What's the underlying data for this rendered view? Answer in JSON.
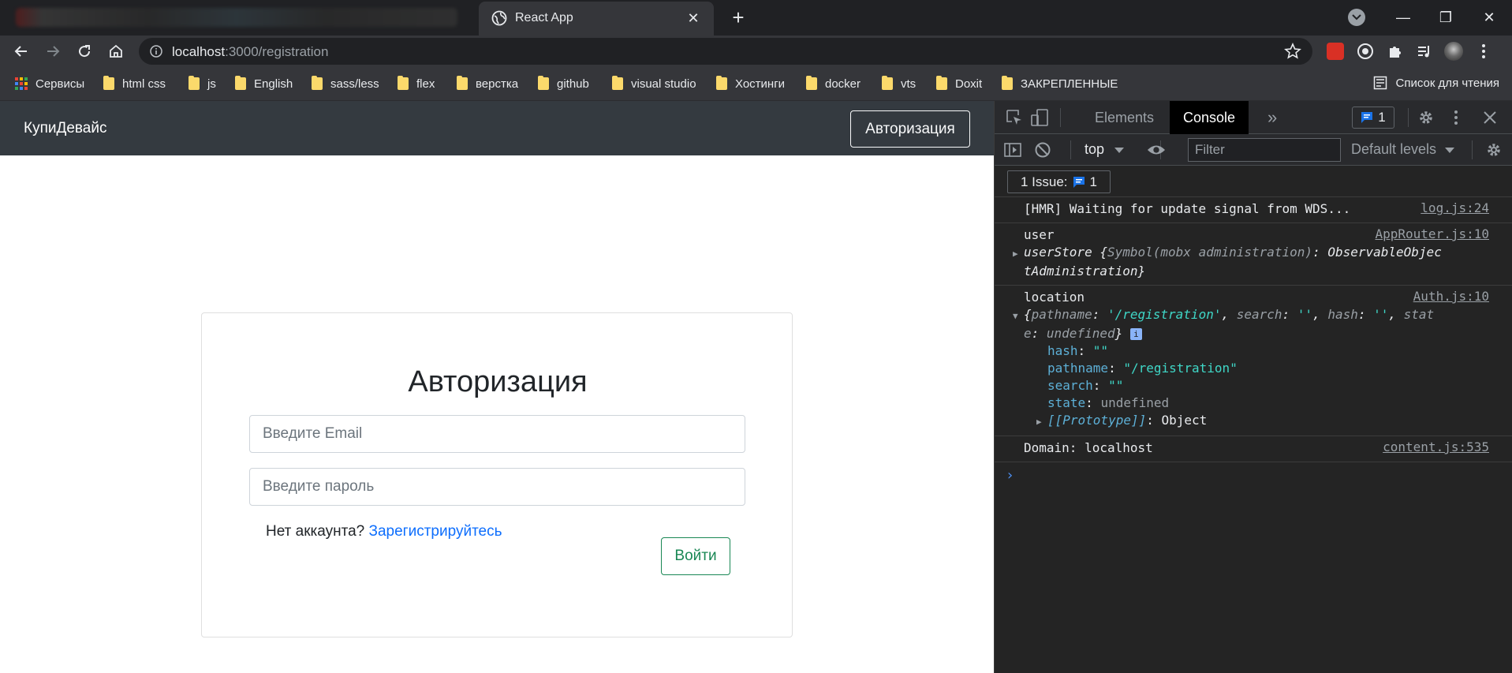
{
  "browser": {
    "tab_title": "React App",
    "tab_close": "✕",
    "new_tab": "+",
    "window_controls": {
      "minimize": "—",
      "restore": "❐",
      "close": "✕"
    },
    "url_host": "localhost",
    "url_path": ":3000/registration",
    "bookmarks": [
      {
        "label": "Сервисы"
      },
      {
        "label": "html css"
      },
      {
        "label": "js"
      },
      {
        "label": "English"
      },
      {
        "label": "sass/less"
      },
      {
        "label": "flex"
      },
      {
        "label": "верстка"
      },
      {
        "label": "github"
      },
      {
        "label": "visual studio"
      },
      {
        "label": "Хостинги"
      },
      {
        "label": "docker"
      },
      {
        "label": "vts"
      },
      {
        "label": "Doxit"
      },
      {
        "label": "ЗАКРЕПЛЕННЫЕ"
      }
    ],
    "reading_list": "Список для чтения"
  },
  "app": {
    "brand": "КупиДевайс",
    "nav_auth": "Авторизация",
    "card_title": "Авторизация",
    "email_placeholder": "Введите Email",
    "password_placeholder": "Введите пароль",
    "no_account": "Нет аккаунта? ",
    "register_link": "Зарегистрируйтесь",
    "login_button": "Войти"
  },
  "devtools": {
    "tabs": {
      "elements": "Elements",
      "console": "Console",
      "more": "»"
    },
    "issues_count": "1",
    "context": "top",
    "filter_placeholder": "Filter",
    "levels": "Default levels",
    "issue_bar_label": "1 Issue:",
    "issue_bar_count": "1",
    "messages": {
      "hmr": {
        "text": "[HMR] Waiting for update signal from WDS...",
        "source": "log.js:24"
      },
      "user": {
        "label": "user",
        "source": "AppRouter.js:10",
        "obj_name": "userStore",
        "obj_open": " {",
        "obj_key": "Symbol(mobx administration)",
        "obj_colon": ": ",
        "obj_val1": "ObservableObjec",
        "obj_val2": "tAdministration",
        "obj_close": "}"
      },
      "location": {
        "label": "location",
        "source": "Auth.js:10",
        "summary_1a": "{",
        "summary_1b": "pathname",
        "summary_1c": ": ",
        "summary_1d": "'/registration'",
        "summary_1e": ", ",
        "summary_1f": "search",
        "summary_1g": ": ",
        "summary_1h": "''",
        "summary_1i": ", ",
        "summary_1j": "hash",
        "summary_1k": ": ",
        "summary_1l": "''",
        "summary_1m": ", ",
        "summary_1n": "stat",
        "summary_2a": "e",
        "summary_2b": ": ",
        "summary_2c": "undefined",
        "summary_2d": "}",
        "info": "i",
        "props": [
          {
            "key": "hash",
            "value": "\"\""
          },
          {
            "key": "pathname",
            "value": "\"/registration\""
          },
          {
            "key": "search",
            "value": "\"\""
          },
          {
            "key": "state",
            "value": "undefined"
          }
        ],
        "proto_key": "[[Prototype]]",
        "proto_val": ": Object"
      },
      "domain": {
        "text": "Domain: localhost",
        "source": "content.js:535"
      }
    },
    "prompt": "›"
  }
}
